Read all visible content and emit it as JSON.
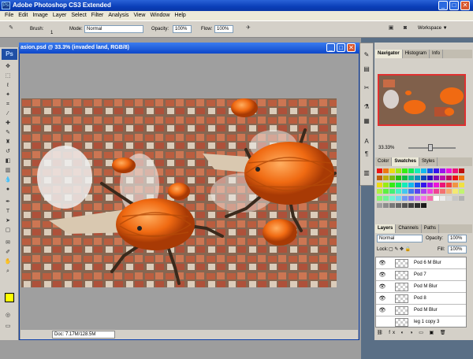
{
  "app": {
    "title": "Adobe Photoshop CS3 Extended",
    "icon": "Ps"
  },
  "window_controls": {
    "minimize": "_",
    "maximize": "□",
    "close": "✕"
  },
  "menu": [
    "File",
    "Edit",
    "Image",
    "Layer",
    "Select",
    "Filter",
    "Analysis",
    "View",
    "Window",
    "Help"
  ],
  "options": {
    "brush_label": "Brush:",
    "brush_size": "1",
    "mode_label": "Mode:",
    "mode": "Normal",
    "opacity_label": "Opacity:",
    "opacity": "100%",
    "flow_label": "Flow:",
    "flow": "100%",
    "workspace": "Workspace ▼"
  },
  "document": {
    "title": "asion.psd @ 33.3% (invaded land, RGB/8)",
    "status": "Doc: 7.17M/128.5M"
  },
  "toolbox": {
    "logo": "Ps"
  },
  "navigator": {
    "tabs": [
      "Navigator",
      "Histogram",
      "Info"
    ],
    "zoom": "33.33%"
  },
  "color_panel": {
    "tabs": [
      "Color",
      "Swatches",
      "Styles"
    ]
  },
  "layers_panel": {
    "tabs": [
      "Layers",
      "Channels",
      "Paths"
    ],
    "blend": "Normal",
    "opacity_label": "Opacity:",
    "opacity": "100%",
    "lock_label": "Lock:",
    "fill_label": "Fill:",
    "fill": "100%",
    "layers": [
      "Pod 6 M Blur",
      "Pod 7",
      "Pod M Blur",
      "Pod 8",
      "Pod M Blur",
      "leg 1 copy 3"
    ]
  },
  "colors": {
    "foreground": "#ffff00",
    "background": "#ffffff",
    "accent": "#0a3fb8"
  }
}
